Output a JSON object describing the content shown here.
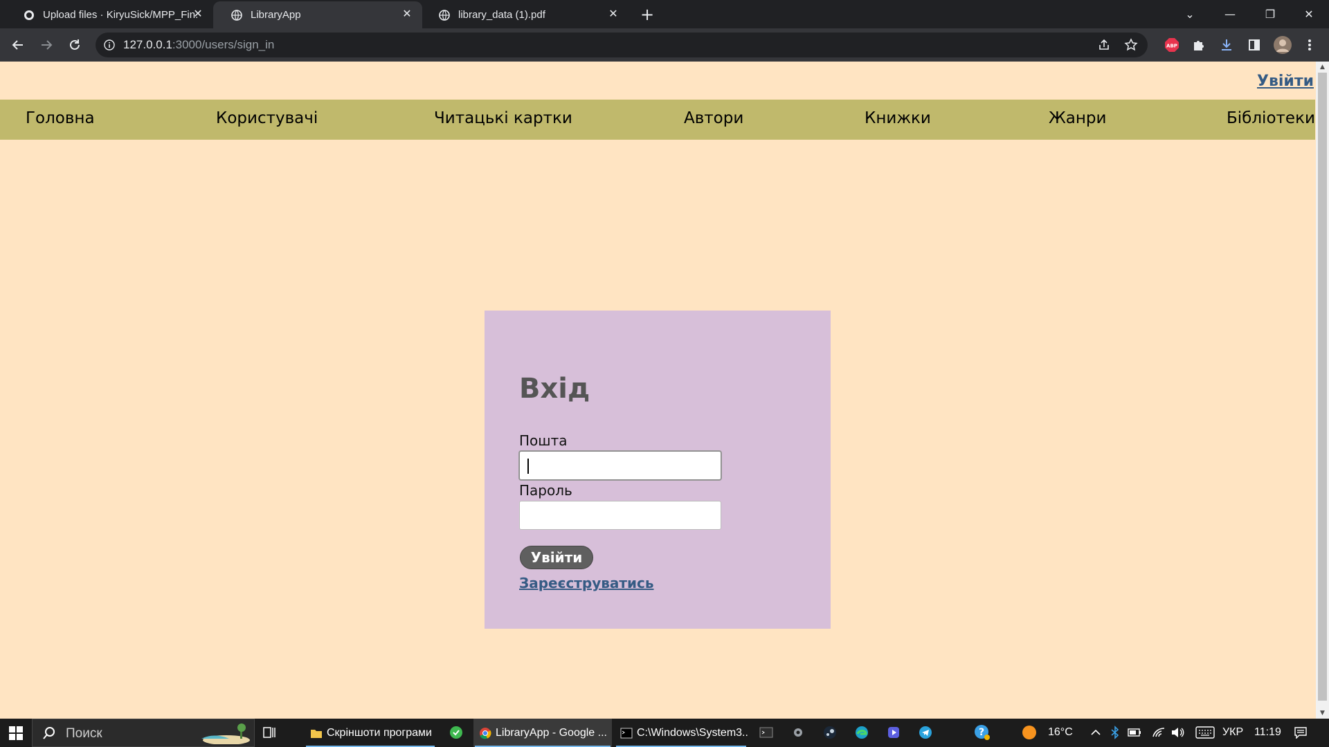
{
  "browser": {
    "tabs": [
      {
        "title": "Upload files · KiryuSick/MPP_Fin..."
      },
      {
        "title": "LibraryApp"
      },
      {
        "title": "library_data (1).pdf"
      }
    ],
    "url_host": "127.0.0.1",
    "url_path": ":3000/users/sign_in",
    "extension_abp": "ABP"
  },
  "page": {
    "top_login_link": "Увійти",
    "nav": [
      "Головна",
      "Користувачі",
      "Читацькі картки",
      "Автори",
      "Книжки",
      "Жанри",
      "Бібліотеки"
    ],
    "login": {
      "title": "Вхід",
      "email_label": "Пошта",
      "email_value": "",
      "password_label": "Пароль",
      "password_value": "",
      "submit_label": "Увійти",
      "register_link": "Зареєструватись"
    }
  },
  "taskbar": {
    "search_placeholder": "Поиск",
    "apps": [
      {
        "label": "Скріншоти програми"
      },
      {
        "label": "LibraryApp - Google ..."
      },
      {
        "label": "C:\\Windows\\System3..."
      }
    ],
    "temperature": "16°C",
    "language": "УКР",
    "time": "11:19"
  },
  "colors": {
    "page_bg": "#ffe4c2",
    "nav_bg": "#c0b96c",
    "card_bg": "#d7bfd9",
    "link": "#355b84"
  }
}
